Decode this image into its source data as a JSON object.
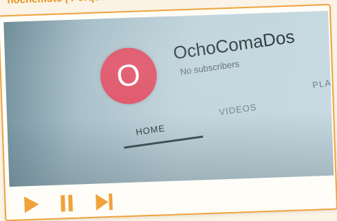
{
  "caption": {
    "text": "nochemote | Porque nosotros"
  },
  "player": {
    "channel": {
      "avatar_letter": "O",
      "name": "OchoComaDos",
      "subscribers": "No subscribers"
    },
    "tabs": [
      {
        "label": "HOME",
        "active": true
      },
      {
        "label": "VIDEOS",
        "active": false
      },
      {
        "label": "PLAY",
        "active": false
      }
    ],
    "controls": {
      "icons": [
        "play-icon",
        "pause-icon",
        "next-track-icon"
      ]
    }
  },
  "colors": {
    "accent": "#f0a33a",
    "avatar": "#de4a60"
  }
}
